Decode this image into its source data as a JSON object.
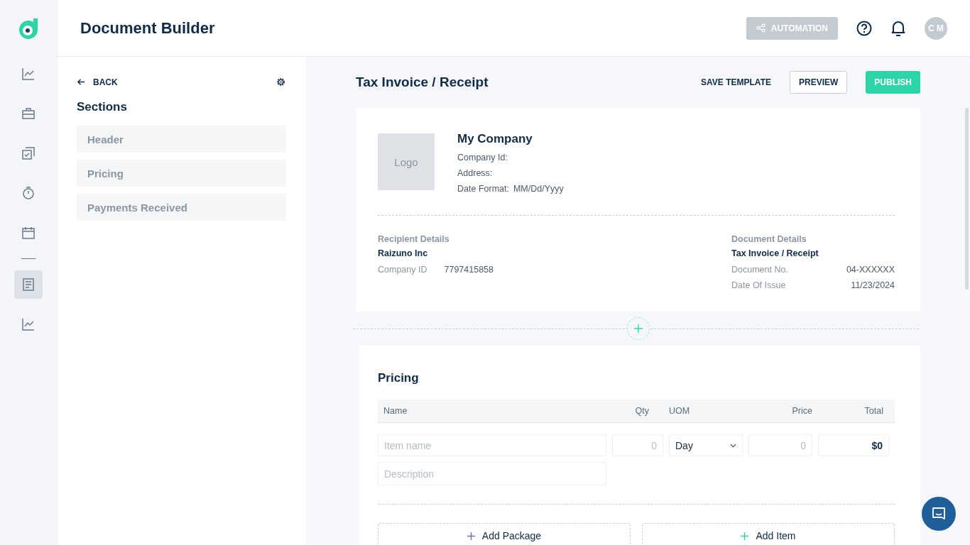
{
  "app": {
    "title": "Document Builder"
  },
  "nav": [
    {
      "kind": "chart",
      "selected": false
    },
    {
      "kind": "briefcase",
      "selected": false
    },
    {
      "kind": "tasks",
      "selected": false
    },
    {
      "kind": "timer",
      "selected": false
    },
    {
      "kind": "calendar",
      "selected": false
    },
    {
      "kind": "document",
      "selected": true
    },
    {
      "kind": "chart",
      "selected": false
    }
  ],
  "header": {
    "automation": "AUTOMATION",
    "avatar": "C M"
  },
  "sidebar": {
    "back": "BACK",
    "title": "Sections",
    "items": [
      {
        "label": "Header",
        "selected": false
      },
      {
        "label": "Pricing",
        "selected": false
      },
      {
        "label": "Payments Received",
        "selected": false
      }
    ]
  },
  "toolbar": {
    "title": "Tax Invoice / Receipt",
    "save": "SAVE TEMPLATE",
    "preview": "PREVIEW",
    "publish": "PUBLISH"
  },
  "company": {
    "logo": "Logo",
    "name": "My Company",
    "lines": [
      {
        "label": "Company Id:"
      },
      {
        "label": "Address:"
      },
      {
        "label": "Date Format:",
        "value": "MM/Dd/Yyyy"
      }
    ]
  },
  "recipient": {
    "heading": "Recipient Details",
    "name": "Raizuno Inc",
    "rows": [
      {
        "label": "Company ID",
        "value": "7797415858"
      }
    ]
  },
  "document": {
    "heading": "Document Details",
    "name": "Tax Invoice / Receipt",
    "rows": [
      {
        "label": "Document No.",
        "value": "04-XXXXXX"
      },
      {
        "label": "Date Of Issue",
        "value": "11/23/2024"
      }
    ]
  },
  "pricing": {
    "title": "Pricing",
    "columns": [
      "Name",
      "Qty",
      "UOM",
      "Price",
      "Total"
    ],
    "item": {
      "name_placeholder": "Item name",
      "qty_placeholder": "0",
      "uom": "Day",
      "price_placeholder": "0",
      "total": "$0",
      "description_placeholder": "Description"
    },
    "add_package": "Add Package",
    "add_item": "Add Item"
  }
}
